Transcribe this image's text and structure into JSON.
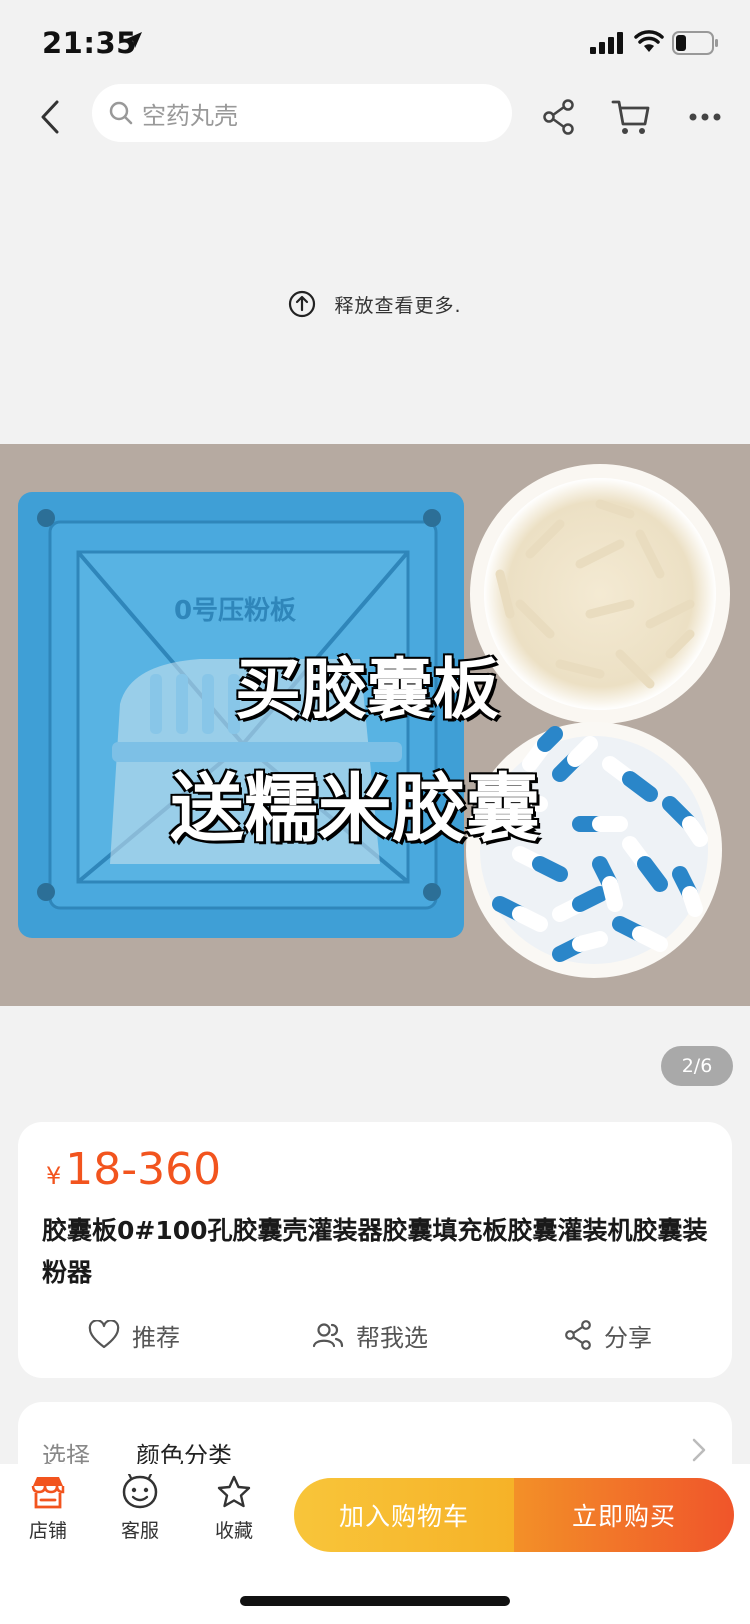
{
  "status_bar": {
    "time": "21:35"
  },
  "nav": {
    "search_placeholder": "空药丸壳"
  },
  "pull_hint": "释放查看更多.",
  "gallery": {
    "overlay_line1": "买胶囊板",
    "overlay_line2": "送糯米胶囊",
    "plate_label": "0号压粉板",
    "page_counter": "2/6"
  },
  "product": {
    "currency_symbol": "¥",
    "price": "18-360",
    "title": "胶囊板0#100孔胶囊壳灌装器胶囊填充板胶囊灌装机胶囊装粉器"
  },
  "actions": [
    {
      "label": "推荐",
      "icon": "heart-icon"
    },
    {
      "label": "帮我选",
      "icon": "people-icon"
    },
    {
      "label": "分享",
      "icon": "share-icon"
    }
  ],
  "options": {
    "key": "选择",
    "value": "颜色分类"
  },
  "bottom_bar": {
    "tabs": [
      {
        "label": "店铺",
        "icon": "store-icon"
      },
      {
        "label": "客服",
        "icon": "service-icon"
      },
      {
        "label": "收藏",
        "icon": "star-icon"
      }
    ],
    "add_to_cart": "加入购物车",
    "buy_now": "立即购买"
  },
  "colors": {
    "price": "#f2541e",
    "accent_orange": "#f0552a",
    "accent_yellow": "#f8c53a"
  }
}
